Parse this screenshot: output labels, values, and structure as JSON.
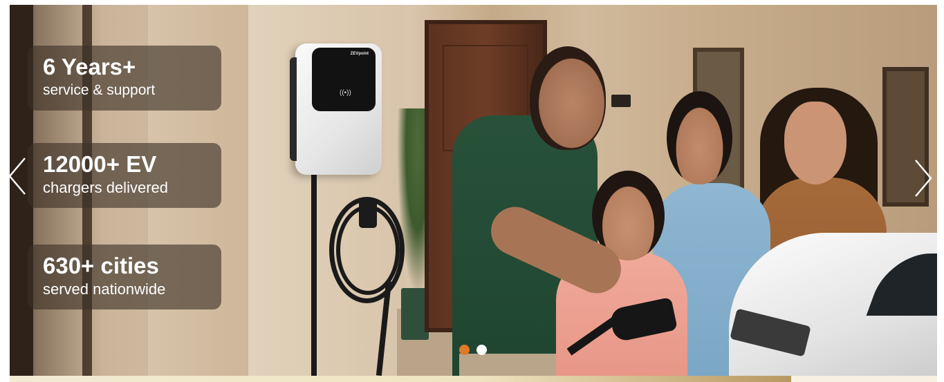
{
  "carousel": {
    "stats": [
      {
        "value": "6 Years+",
        "label": "service & support"
      },
      {
        "value": "12000+ EV",
        "label": "chargers delivered"
      },
      {
        "value": "630+ cities",
        "label": "served nationwide"
      }
    ],
    "charger_brand": "ZEVpoint",
    "slides_total": 2,
    "active_slide": 1,
    "prev_icon": "chevron-left-icon",
    "next_icon": "chevron-right-icon",
    "active_dot_color": "#e07a27",
    "inactive_dot_color": "#ffffff"
  }
}
